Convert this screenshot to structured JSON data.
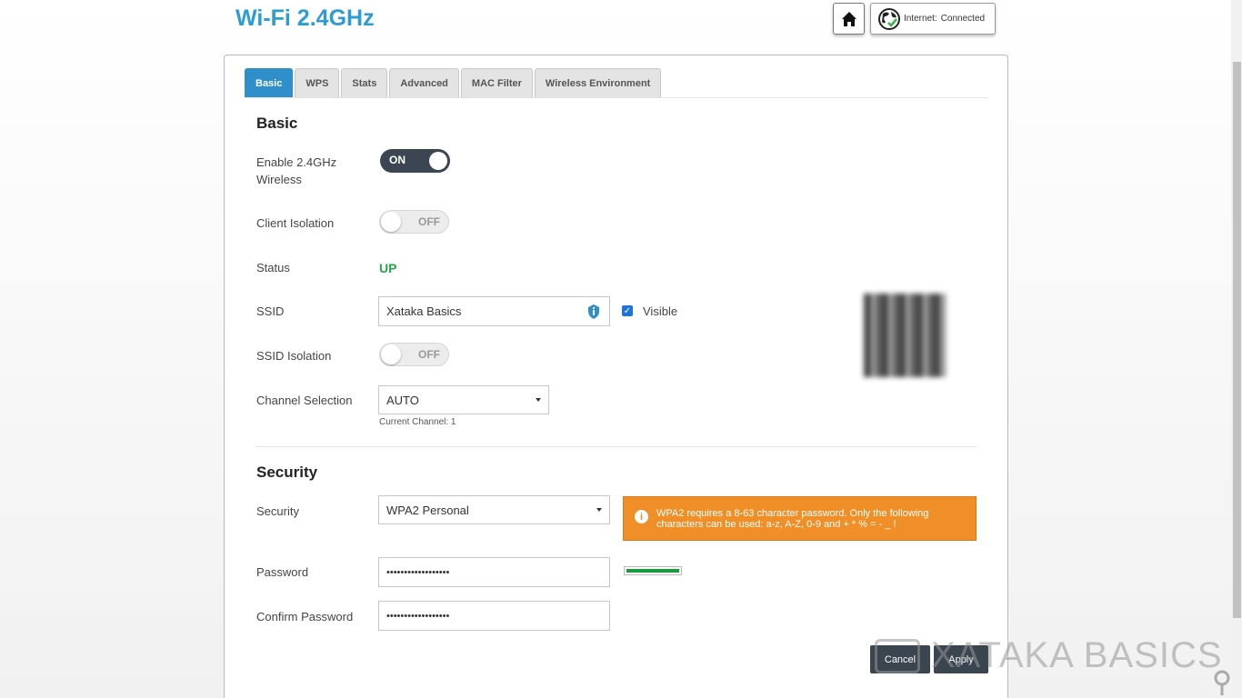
{
  "header": {
    "title": "Wi-Fi 2.4GHz",
    "internet_label": "Internet:",
    "internet_status": "Connected"
  },
  "tabs": [
    {
      "label": "Basic",
      "active": true
    },
    {
      "label": "WPS",
      "active": false
    },
    {
      "label": "Stats",
      "active": false
    },
    {
      "label": "Advanced",
      "active": false
    },
    {
      "label": "MAC Filter",
      "active": false
    },
    {
      "label": "Wireless Environment",
      "active": false
    }
  ],
  "basic": {
    "title": "Basic",
    "enable_wireless_label": "Enable 2.4GHz Wireless",
    "enable_wireless_state": "ON",
    "client_isolation_label": "Client Isolation",
    "client_isolation_state": "OFF",
    "status_label": "Status",
    "status_value": "UP",
    "ssid_label": "SSID",
    "ssid_value": "Xataka Basics",
    "visible_label": "Visible",
    "visible_checked": true,
    "ssid_isolation_label": "SSID Isolation",
    "ssid_isolation_state": "OFF",
    "channel_label": "Channel Selection",
    "channel_value": "AUTO",
    "current_channel": "Current Channel: 1"
  },
  "security": {
    "title": "Security",
    "security_label": "Security",
    "security_value": "WPA2 Personal",
    "warning_text": "WPA2 requires a 8-63 character password. Only the following characters can be used: a-z, A-Z, 0-9 and + * % = - _ !",
    "password_label": "Password",
    "password_value": "••••••••••••••••••",
    "confirm_label": "Confirm Password",
    "confirm_value": "••••••••••••••••••",
    "strength_fraction": 1.0
  },
  "actions": {
    "cancel_label": "Cancel",
    "apply_label": "Apply"
  },
  "watermark": "XATAKA BASICS",
  "colors": {
    "accent": "#2f9bd3",
    "active_tab": "#2f8fcb",
    "status_up": "#27a745",
    "warning": "#f08f27",
    "strength": "#1a9b3d",
    "button_dark": "#3a4550"
  },
  "icons": [
    "home-icon",
    "globe-icon",
    "info-icon",
    "checkbox-check-icon",
    "qr-code-image"
  ]
}
